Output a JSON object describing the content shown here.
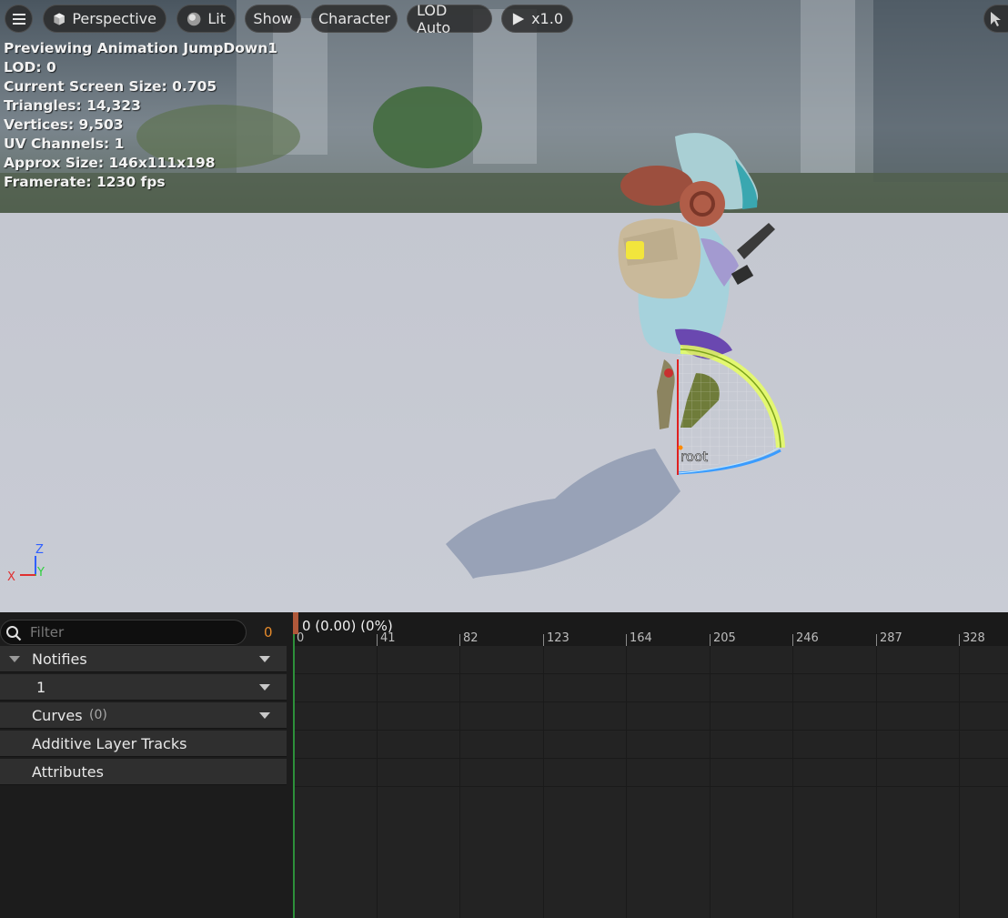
{
  "toolbar": {
    "menu_icon": "hamburger-icon",
    "perspective_label": "Perspective",
    "lit_label": "Lit",
    "show_label": "Show",
    "character_label": "Character",
    "lod_label": "LOD Auto",
    "play_speed_label": "x1.0",
    "select_icon": "cursor-icon"
  },
  "stats": {
    "lines": [
      "Previewing Animation JumpDown1",
      "LOD: 0",
      "Current Screen Size: 0.705",
      "Triangles: 14,323",
      "Vertices: 9,503",
      "UV Channels: 1",
      "Approx Size: 146x111x198",
      "Framerate: 1230 fps"
    ]
  },
  "scene": {
    "bone_label": "root",
    "axis_x": "X",
    "axis_y": "Y",
    "axis_z": "Z",
    "colors": {
      "x_axis": "#e03030",
      "y_axis": "#30d040",
      "z_axis": "#3060ff",
      "gizmo_yellow": "#e8ff60",
      "gizmo_blue": "#3a9cff"
    }
  },
  "tracks": {
    "filter_placeholder": "Filter",
    "filter_count": "0",
    "notifies_label": "Notifies",
    "notify_track_label": "1",
    "curves_label": "Curves",
    "curves_count": "(0)",
    "additive_label": "Additive Layer Tracks",
    "attributes_label": "Attributes"
  },
  "timeline": {
    "frame_readout": "0 (0.00) (0%)",
    "ticks": [
      "0",
      "41",
      "82",
      "123",
      "164",
      "205",
      "246",
      "287",
      "328"
    ]
  }
}
